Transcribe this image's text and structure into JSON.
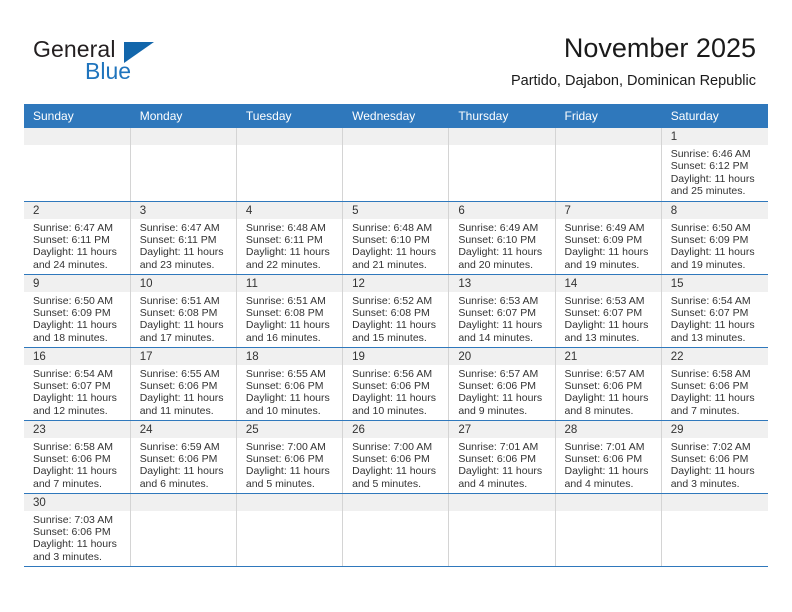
{
  "brand": {
    "name_part1": "General",
    "name_part2": "Blue",
    "accent_color": "#1266ab"
  },
  "header": {
    "title": "November 2025",
    "subtitle": "Partido, Dajabon, Dominican Republic"
  },
  "theme": {
    "header_blue": "#2f78bc",
    "daynum_background": "#f0f0f0",
    "text_color": "#333333"
  },
  "weekdays": [
    "Sunday",
    "Monday",
    "Tuesday",
    "Wednesday",
    "Thursday",
    "Friday",
    "Saturday"
  ],
  "weeks": [
    [
      {
        "day": "",
        "sunrise": "",
        "sunset": "",
        "daylight_1": "",
        "daylight_2": ""
      },
      {
        "day": "",
        "sunrise": "",
        "sunset": "",
        "daylight_1": "",
        "daylight_2": ""
      },
      {
        "day": "",
        "sunrise": "",
        "sunset": "",
        "daylight_1": "",
        "daylight_2": ""
      },
      {
        "day": "",
        "sunrise": "",
        "sunset": "",
        "daylight_1": "",
        "daylight_2": ""
      },
      {
        "day": "",
        "sunrise": "",
        "sunset": "",
        "daylight_1": "",
        "daylight_2": ""
      },
      {
        "day": "",
        "sunrise": "",
        "sunset": "",
        "daylight_1": "",
        "daylight_2": ""
      },
      {
        "day": "1",
        "sunrise": "Sunrise: 6:46 AM",
        "sunset": "Sunset: 6:12 PM",
        "daylight_1": "Daylight: 11 hours",
        "daylight_2": "and 25 minutes."
      }
    ],
    [
      {
        "day": "2",
        "sunrise": "Sunrise: 6:47 AM",
        "sunset": "Sunset: 6:11 PM",
        "daylight_1": "Daylight: 11 hours",
        "daylight_2": "and 24 minutes."
      },
      {
        "day": "3",
        "sunrise": "Sunrise: 6:47 AM",
        "sunset": "Sunset: 6:11 PM",
        "daylight_1": "Daylight: 11 hours",
        "daylight_2": "and 23 minutes."
      },
      {
        "day": "4",
        "sunrise": "Sunrise: 6:48 AM",
        "sunset": "Sunset: 6:11 PM",
        "daylight_1": "Daylight: 11 hours",
        "daylight_2": "and 22 minutes."
      },
      {
        "day": "5",
        "sunrise": "Sunrise: 6:48 AM",
        "sunset": "Sunset: 6:10 PM",
        "daylight_1": "Daylight: 11 hours",
        "daylight_2": "and 21 minutes."
      },
      {
        "day": "6",
        "sunrise": "Sunrise: 6:49 AM",
        "sunset": "Sunset: 6:10 PM",
        "daylight_1": "Daylight: 11 hours",
        "daylight_2": "and 20 minutes."
      },
      {
        "day": "7",
        "sunrise": "Sunrise: 6:49 AM",
        "sunset": "Sunset: 6:09 PM",
        "daylight_1": "Daylight: 11 hours",
        "daylight_2": "and 19 minutes."
      },
      {
        "day": "8",
        "sunrise": "Sunrise: 6:50 AM",
        "sunset": "Sunset: 6:09 PM",
        "daylight_1": "Daylight: 11 hours",
        "daylight_2": "and 19 minutes."
      }
    ],
    [
      {
        "day": "9",
        "sunrise": "Sunrise: 6:50 AM",
        "sunset": "Sunset: 6:09 PM",
        "daylight_1": "Daylight: 11 hours",
        "daylight_2": "and 18 minutes."
      },
      {
        "day": "10",
        "sunrise": "Sunrise: 6:51 AM",
        "sunset": "Sunset: 6:08 PM",
        "daylight_1": "Daylight: 11 hours",
        "daylight_2": "and 17 minutes."
      },
      {
        "day": "11",
        "sunrise": "Sunrise: 6:51 AM",
        "sunset": "Sunset: 6:08 PM",
        "daylight_1": "Daylight: 11 hours",
        "daylight_2": "and 16 minutes."
      },
      {
        "day": "12",
        "sunrise": "Sunrise: 6:52 AM",
        "sunset": "Sunset: 6:08 PM",
        "daylight_1": "Daylight: 11 hours",
        "daylight_2": "and 15 minutes."
      },
      {
        "day": "13",
        "sunrise": "Sunrise: 6:53 AM",
        "sunset": "Sunset: 6:07 PM",
        "daylight_1": "Daylight: 11 hours",
        "daylight_2": "and 14 minutes."
      },
      {
        "day": "14",
        "sunrise": "Sunrise: 6:53 AM",
        "sunset": "Sunset: 6:07 PM",
        "daylight_1": "Daylight: 11 hours",
        "daylight_2": "and 13 minutes."
      },
      {
        "day": "15",
        "sunrise": "Sunrise: 6:54 AM",
        "sunset": "Sunset: 6:07 PM",
        "daylight_1": "Daylight: 11 hours",
        "daylight_2": "and 13 minutes."
      }
    ],
    [
      {
        "day": "16",
        "sunrise": "Sunrise: 6:54 AM",
        "sunset": "Sunset: 6:07 PM",
        "daylight_1": "Daylight: 11 hours",
        "daylight_2": "and 12 minutes."
      },
      {
        "day": "17",
        "sunrise": "Sunrise: 6:55 AM",
        "sunset": "Sunset: 6:06 PM",
        "daylight_1": "Daylight: 11 hours",
        "daylight_2": "and 11 minutes."
      },
      {
        "day": "18",
        "sunrise": "Sunrise: 6:55 AM",
        "sunset": "Sunset: 6:06 PM",
        "daylight_1": "Daylight: 11 hours",
        "daylight_2": "and 10 minutes."
      },
      {
        "day": "19",
        "sunrise": "Sunrise: 6:56 AM",
        "sunset": "Sunset: 6:06 PM",
        "daylight_1": "Daylight: 11 hours",
        "daylight_2": "and 10 minutes."
      },
      {
        "day": "20",
        "sunrise": "Sunrise: 6:57 AM",
        "sunset": "Sunset: 6:06 PM",
        "daylight_1": "Daylight: 11 hours",
        "daylight_2": "and 9 minutes."
      },
      {
        "day": "21",
        "sunrise": "Sunrise: 6:57 AM",
        "sunset": "Sunset: 6:06 PM",
        "daylight_1": "Daylight: 11 hours",
        "daylight_2": "and 8 minutes."
      },
      {
        "day": "22",
        "sunrise": "Sunrise: 6:58 AM",
        "sunset": "Sunset: 6:06 PM",
        "daylight_1": "Daylight: 11 hours",
        "daylight_2": "and 7 minutes."
      }
    ],
    [
      {
        "day": "23",
        "sunrise": "Sunrise: 6:58 AM",
        "sunset": "Sunset: 6:06 PM",
        "daylight_1": "Daylight: 11 hours",
        "daylight_2": "and 7 minutes."
      },
      {
        "day": "24",
        "sunrise": "Sunrise: 6:59 AM",
        "sunset": "Sunset: 6:06 PM",
        "daylight_1": "Daylight: 11 hours",
        "daylight_2": "and 6 minutes."
      },
      {
        "day": "25",
        "sunrise": "Sunrise: 7:00 AM",
        "sunset": "Sunset: 6:06 PM",
        "daylight_1": "Daylight: 11 hours",
        "daylight_2": "and 5 minutes."
      },
      {
        "day": "26",
        "sunrise": "Sunrise: 7:00 AM",
        "sunset": "Sunset: 6:06 PM",
        "daylight_1": "Daylight: 11 hours",
        "daylight_2": "and 5 minutes."
      },
      {
        "day": "27",
        "sunrise": "Sunrise: 7:01 AM",
        "sunset": "Sunset: 6:06 PM",
        "daylight_1": "Daylight: 11 hours",
        "daylight_2": "and 4 minutes."
      },
      {
        "day": "28",
        "sunrise": "Sunrise: 7:01 AM",
        "sunset": "Sunset: 6:06 PM",
        "daylight_1": "Daylight: 11 hours",
        "daylight_2": "and 4 minutes."
      },
      {
        "day": "29",
        "sunrise": "Sunrise: 7:02 AM",
        "sunset": "Sunset: 6:06 PM",
        "daylight_1": "Daylight: 11 hours",
        "daylight_2": "and 3 minutes."
      }
    ],
    [
      {
        "day": "30",
        "sunrise": "Sunrise: 7:03 AM",
        "sunset": "Sunset: 6:06 PM",
        "daylight_1": "Daylight: 11 hours",
        "daylight_2": "and 3 minutes."
      },
      {
        "day": "",
        "sunrise": "",
        "sunset": "",
        "daylight_1": "",
        "daylight_2": ""
      },
      {
        "day": "",
        "sunrise": "",
        "sunset": "",
        "daylight_1": "",
        "daylight_2": ""
      },
      {
        "day": "",
        "sunrise": "",
        "sunset": "",
        "daylight_1": "",
        "daylight_2": ""
      },
      {
        "day": "",
        "sunrise": "",
        "sunset": "",
        "daylight_1": "",
        "daylight_2": ""
      },
      {
        "day": "",
        "sunrise": "",
        "sunset": "",
        "daylight_1": "",
        "daylight_2": ""
      },
      {
        "day": "",
        "sunrise": "",
        "sunset": "",
        "daylight_1": "",
        "daylight_2": ""
      }
    ]
  ]
}
